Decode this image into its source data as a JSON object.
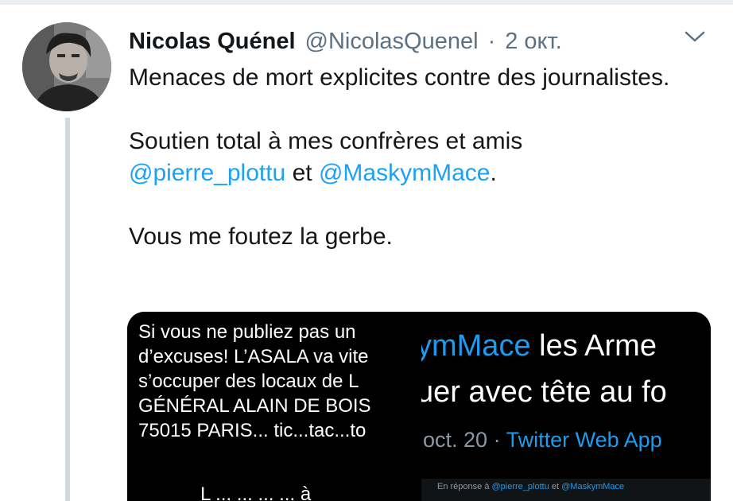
{
  "tweet": {
    "author_name": "Nicolas Quénel",
    "author_handle": "@NicolasQuenel",
    "separator": "·",
    "date": "2 окт.",
    "line1": "Menaces de mort explicites contre des journalistes.",
    "line2_prefix": "Soutien total à mes confrères et amis",
    "mention1": "@pierre_plottu",
    "conjunction": "et",
    "mention2": "@MaskymMace",
    "period": ".",
    "line3": "Vous me foutez la gerbe."
  },
  "media": {
    "tile_a_lines": [
      "Si vous ne publiez pas un",
      "d’excuses! L’ASALA va vite",
      "s’occuper des locaux de L",
      "GÉNÉRAL ALAIN DE BOIS",
      "75015 PARIS... tic...tac...to"
    ],
    "tile_b_mention_fragment": "ymMace",
    "tile_b_text_rest": " les Arme",
    "tile_b_line2": "uer avec tête au fo",
    "tile_b_date": "oct. 20",
    "tile_b_sep": " · ",
    "tile_b_app": "Twitter Web App",
    "tile_c_text": "L ... ... ... ... à",
    "tile_d_prefix": "En réponse à ",
    "tile_d_mention1": "@pierre_plottu",
    "tile_d_and": " et ",
    "tile_d_mention2": "@MaskymMace"
  },
  "icons": {
    "caret": "chevron-down-icon",
    "avatar": "profile-photo"
  },
  "colors": {
    "link": "#1da1f2",
    "muted": "#5b7083",
    "text": "#14171a"
  }
}
